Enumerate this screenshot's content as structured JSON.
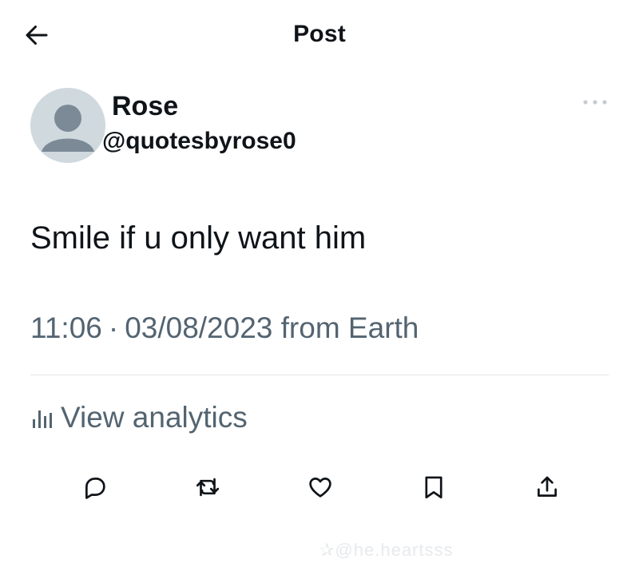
{
  "header": {
    "title": "Post",
    "back_icon": "arrow-left-icon"
  },
  "author": {
    "name": "Rose",
    "handle": "@quotesbyrose0",
    "avatar_icon": "default-avatar-icon"
  },
  "post": {
    "text": "Smile if u only want him",
    "time": "11:06",
    "separator": "·",
    "date": "03/08/2023",
    "source": "from Earth"
  },
  "analytics": {
    "label": "View analytics",
    "icon": "analytics-bars-icon"
  },
  "actions": [
    {
      "name": "reply",
      "icon": "reply-icon"
    },
    {
      "name": "repost",
      "icon": "repost-icon"
    },
    {
      "name": "like",
      "icon": "heart-icon"
    },
    {
      "name": "bookmark",
      "icon": "bookmark-icon"
    },
    {
      "name": "share",
      "icon": "share-icon"
    }
  ],
  "watermark": "✰@he.heartsss",
  "colors": {
    "text_primary": "#0f1419",
    "text_secondary": "#536471",
    "divider": "#e1e6ea",
    "avatar_bg": "#cfd9de"
  }
}
